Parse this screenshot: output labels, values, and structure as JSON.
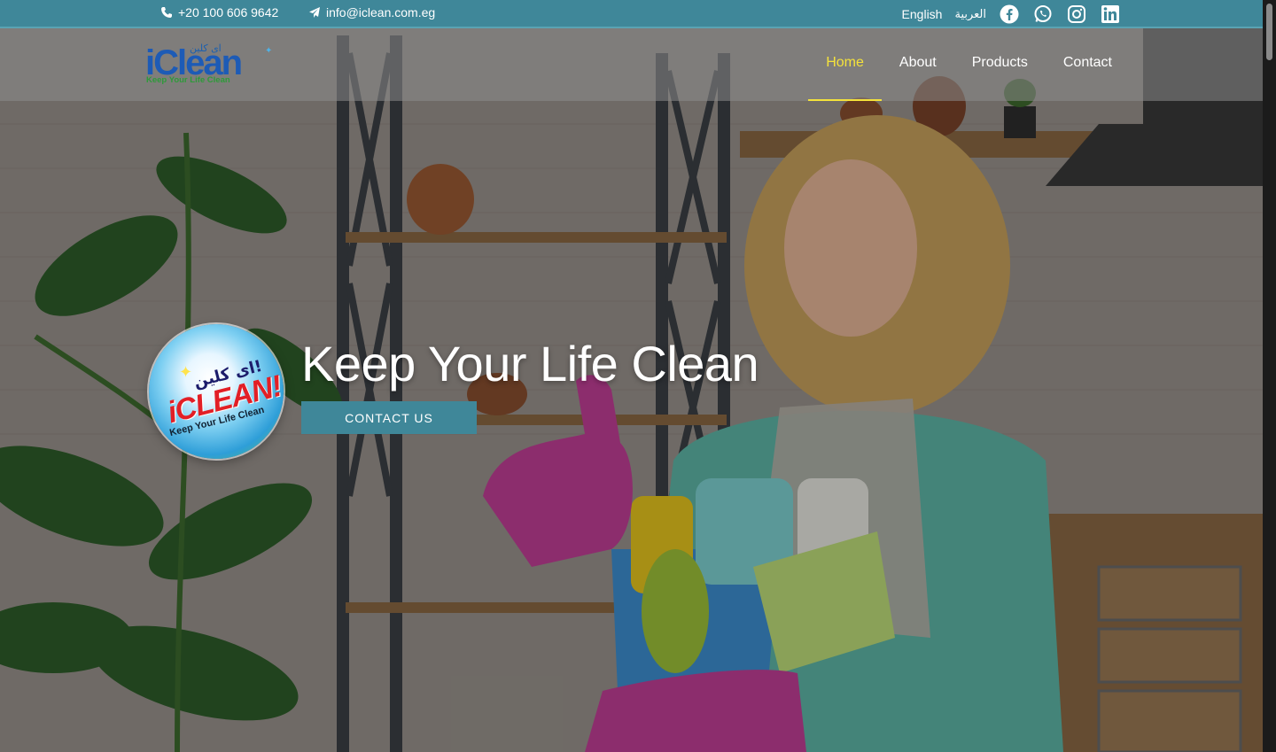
{
  "topbar": {
    "phone": "+20 100 606 9642",
    "email": "info@iclean.com.eg",
    "lang_en": "English",
    "lang_ar": "العربية",
    "social": [
      "facebook-icon",
      "whatsapp-icon",
      "instagram-icon",
      "linkedin-icon"
    ],
    "bg_color": "#3f8799"
  },
  "logo": {
    "brand": "iClean",
    "arabic": "اى كلين",
    "tagline": "Keep Your Life Clean"
  },
  "nav": {
    "items": [
      "Home",
      "About",
      "Products",
      "Contact"
    ],
    "active": "Home",
    "active_color": "#f4e23b"
  },
  "hero": {
    "headline": "Keep Your Life Clean",
    "cta_label": "CONTACT US",
    "badge": {
      "arabic": "اى كلين!",
      "main": "iCLEAN!",
      "sub": "Keep Your Life Clean"
    }
  }
}
